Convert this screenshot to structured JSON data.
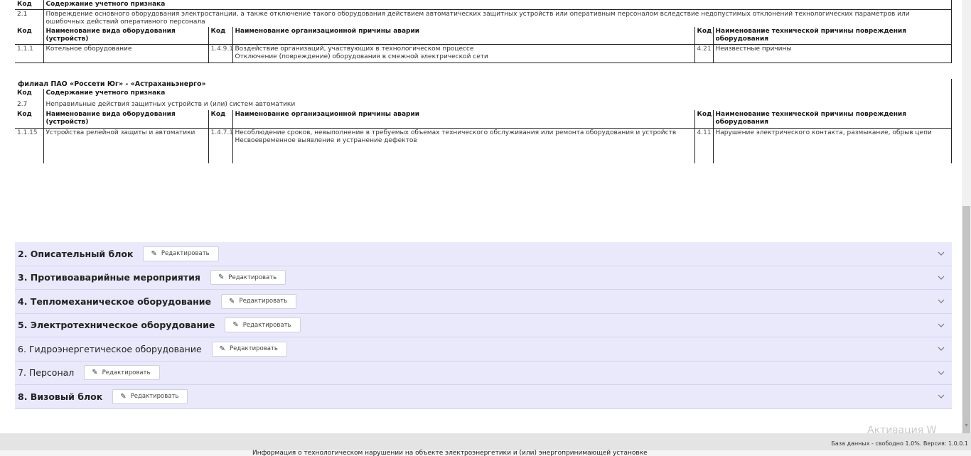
{
  "block1": {
    "header": {
      "code": "Код",
      "content": "Содержание учетного признака"
    },
    "feature": {
      "code": "2.1",
      "text": "Повреждение основного оборудования электростанции, а также отключение такого оборудования действием автоматических защитных устройств или оперативным персоналом вследствие недопустимых отклонений технологических параметров или ошибочных действий оперативного персонала"
    },
    "cols": {
      "code": "Код",
      "equipment": "Наименование вида оборудования (устройств)",
      "code2": "Код",
      "org_cause": "Наименование организационной причины аварии",
      "code3": "Код",
      "tech_cause": "Наименование технической причины повреждения оборудования"
    },
    "row": {
      "code": "1.1.1",
      "equipment": "Котельное оборудование",
      "code2": "1.4.9.1",
      "org_cause_1": "Воздействие организаций, участвующих в технологическом процессе",
      "org_cause_2": "Отключение (повреждение) оборудования в смежной электрической сети",
      "code3": "4.21",
      "tech_cause": "Неизвестные причины"
    }
  },
  "block2": {
    "title": "филиал ПАО «Россети Юг» - «Астраханьэнерго»",
    "header": {
      "code": "Код",
      "content": "Содержание учетного признака"
    },
    "feature": {
      "code": "2.7",
      "text": "Неправильные действия защитных устройств и (или) систем автоматики"
    },
    "cols": {
      "code": "Код",
      "equipment": "Наименование вида оборудования (устройств)",
      "code2": "Код",
      "org_cause": "Наименование организационной причины аварии",
      "code3": "Код",
      "tech_cause": "Наименование технической причины повреждения оборудования"
    },
    "row": {
      "code": "1.1.15",
      "equipment": "Устройства релейной защиты и автоматики",
      "code2": "1.4.7.1",
      "org_cause_1": "Несоблюдение сроков, невыполнение в требуемых объемах технического обслуживания или ремонта оборудования и устройств",
      "org_cause_2": "Несвоевременное выявление и устранение дефектов",
      "code3": "4.11",
      "tech_cause": "Нарушение электрического контакта, размыкание, обрыв цепи"
    }
  },
  "sections": [
    {
      "title": "2. Описательный блок",
      "bold": true,
      "edit": "Редактировать"
    },
    {
      "title": "3. Противоаварийные мероприятия",
      "bold": true,
      "edit": "Редактировать"
    },
    {
      "title": "4. Тепломеханическое оборудование",
      "bold": true,
      "edit": "Редактировать"
    },
    {
      "title": "5. Электротехническое оборудование",
      "bold": true,
      "edit": "Редактировать"
    },
    {
      "title": "6. Гидроэнергетическое оборудование",
      "bold": false,
      "edit": "Редактировать"
    },
    {
      "title": "7. Персонал",
      "bold": false,
      "edit": "Редактировать"
    },
    {
      "title": "8. Визовый блок",
      "bold": true,
      "edit": "Редактировать"
    }
  ],
  "footer": {
    "db_info": "База данных - свободно 1.0%. Версия: 1.0.0.1",
    "watermark": "Активация W",
    "bottom_text": "Информация о технологическом нарушении на объекте электроэнергетики и (или) энергопринимающей установке"
  },
  "icons": {
    "pencil": "pencil-icon",
    "chevron": "chevron-down-icon"
  }
}
